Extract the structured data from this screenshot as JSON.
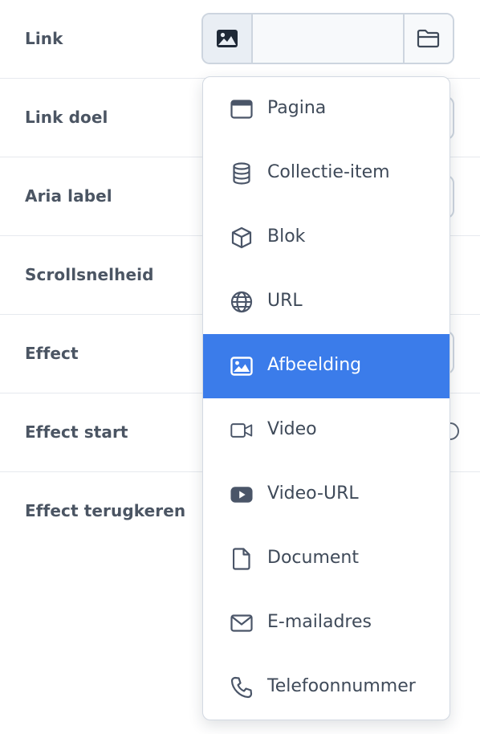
{
  "fields": [
    {
      "label": "Link"
    },
    {
      "label": "Link doel"
    },
    {
      "label": "Aria label"
    },
    {
      "label": "Scrollsnelheid"
    },
    {
      "label": "Effect"
    },
    {
      "label": "Effect start"
    },
    {
      "label": "Effect terugkeren"
    }
  ],
  "link_control": {
    "type_icon": "image-icon",
    "value": "",
    "browse_icon": "folder-open-icon"
  },
  "link_type_menu": {
    "selected": "Afbeelding",
    "items": [
      {
        "label": "Pagina",
        "icon": "browser-window-icon"
      },
      {
        "label": "Collectie-item",
        "icon": "database-icon"
      },
      {
        "label": "Blok",
        "icon": "cube-icon"
      },
      {
        "label": "URL",
        "icon": "globe-icon"
      },
      {
        "label": "Afbeelding",
        "icon": "image-icon"
      },
      {
        "label": "Video",
        "icon": "video-camera-icon"
      },
      {
        "label": "Video-URL",
        "icon": "youtube-icon"
      },
      {
        "label": "Document",
        "icon": "document-icon"
      },
      {
        "label": "E-mailadres",
        "icon": "envelope-icon"
      },
      {
        "label": "Telefoonnummer",
        "icon": "phone-icon"
      }
    ]
  },
  "colors": {
    "accent": "#3b7cea",
    "label_text": "#4b5563",
    "border": "#cdd5df"
  }
}
